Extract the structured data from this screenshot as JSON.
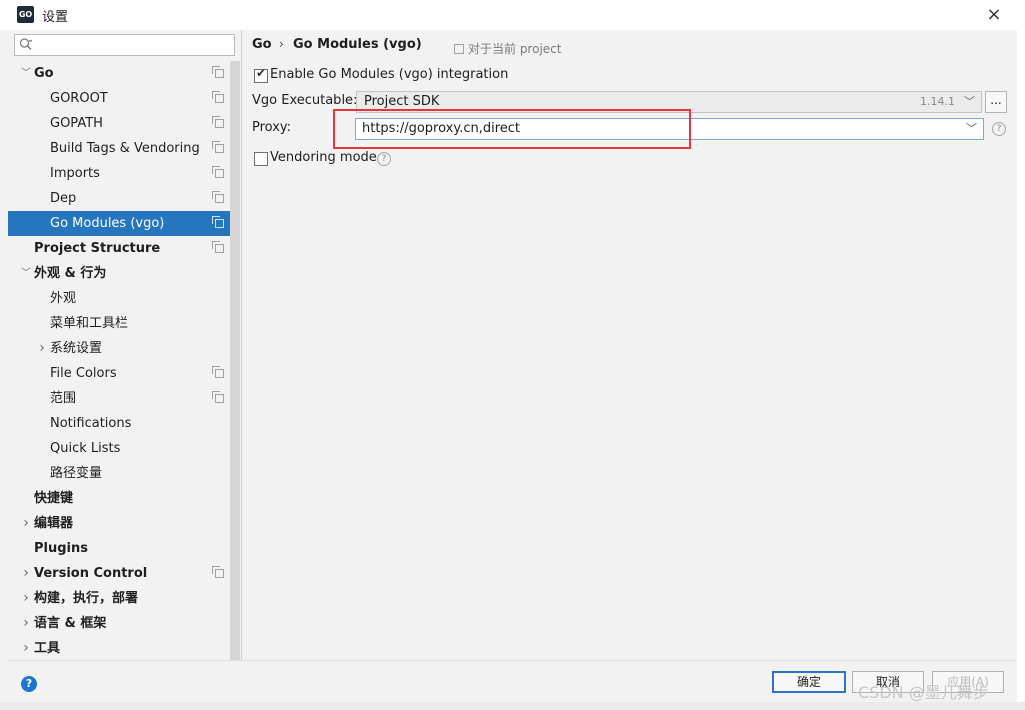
{
  "window": {
    "title": "设置",
    "app_icon": "GO",
    "close": "×"
  },
  "search": {
    "placeholder": ""
  },
  "tree": [
    {
      "label": "Go",
      "level": 0,
      "expanded": true,
      "bold": true,
      "copy": true
    },
    {
      "label": "GOROOT",
      "level": 1,
      "copy": true
    },
    {
      "label": "GOPATH",
      "level": 1,
      "copy": true
    },
    {
      "label": "Build Tags & Vendoring",
      "level": 1,
      "copy": true
    },
    {
      "label": "Imports",
      "level": 1,
      "copy": true
    },
    {
      "label": "Dep",
      "level": 1,
      "copy": true
    },
    {
      "label": "Go Modules (vgo)",
      "level": 1,
      "selected": true,
      "copy": true
    },
    {
      "label": "Project Structure",
      "level": 0,
      "bold": true,
      "copy": true
    },
    {
      "label": "外观 & 行为",
      "level": 0,
      "expanded": true,
      "bold": true
    },
    {
      "label": "外观",
      "level": 1
    },
    {
      "label": "菜单和工具栏",
      "level": 1
    },
    {
      "label": "系统设置",
      "level": 1,
      "collapsed": true
    },
    {
      "label": "File Colors",
      "level": 1,
      "copy": true
    },
    {
      "label": "范围",
      "level": 1,
      "copy": true
    },
    {
      "label": "Notifications",
      "level": 1
    },
    {
      "label": "Quick Lists",
      "level": 1
    },
    {
      "label": "路径变量",
      "level": 1
    },
    {
      "label": "快捷键",
      "level": 0,
      "bold": true
    },
    {
      "label": "编辑器",
      "level": 0,
      "collapsed": true,
      "bold": true
    },
    {
      "label": "Plugins",
      "level": 0,
      "bold": true
    },
    {
      "label": "Version Control",
      "level": 0,
      "collapsed": true,
      "bold": true,
      "copy": true
    },
    {
      "label": "构建，执行，部署",
      "level": 0,
      "collapsed": true,
      "bold": true
    },
    {
      "label": "语言 & 框架",
      "level": 0,
      "collapsed": true,
      "bold": true
    },
    {
      "label": "工具",
      "level": 0,
      "collapsed": true,
      "bold": true
    }
  ],
  "breadcrumb": {
    "root": "Go",
    "separator": "›",
    "current": "Go Modules (vgo)",
    "project_note": "对于当前 project"
  },
  "settings": {
    "enable_label": "Enable Go Modules (vgo) integration",
    "enable_checked": true,
    "vgo_label": "Vgo Executable:",
    "vgo_value": "Project SDK",
    "vgo_version": "1.14.1",
    "dots": "...",
    "proxy_label": "Proxy:",
    "proxy_value": "https://goproxy.cn,direct",
    "vendoring_label": "Vendoring mode",
    "vendoring_checked": false,
    "help": "?"
  },
  "buttons": {
    "ok": "确定",
    "cancel": "取消",
    "apply": "应用(A)",
    "help": "?"
  },
  "watermark": "CSDN @墨儿舞步",
  "colors": {
    "selection": "#2675bf",
    "highlight_box": "#e6353b"
  }
}
